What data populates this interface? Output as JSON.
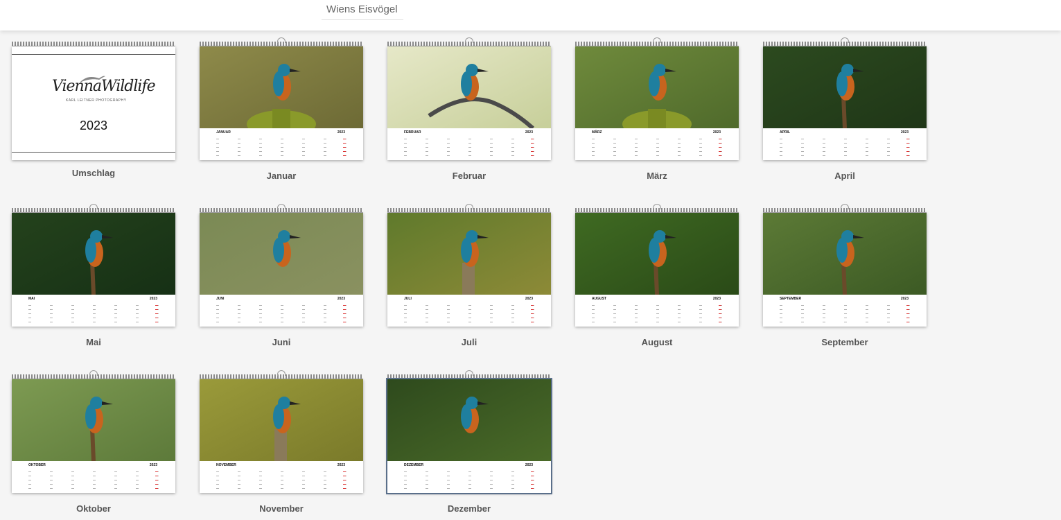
{
  "header": {
    "title": "Wiens Eisvögel"
  },
  "cover": {
    "label": "Umschlag",
    "logo": "ViennaWildlife",
    "logo_sub": "KARL LEITNER PHOTOGRAPHY",
    "year": "2023"
  },
  "months": [
    {
      "label": "Januar",
      "cal_name": "JANUAR",
      "year": "2023",
      "bg": [
        "#8e8a4a",
        "#6d6a35"
      ],
      "perch": "moss"
    },
    {
      "label": "Februar",
      "cal_name": "FEBRUAR",
      "year": "2023",
      "bg": [
        "#e6e8c8",
        "#c7cf9a"
      ],
      "perch": "branch"
    },
    {
      "label": "März",
      "cal_name": "MÄRZ",
      "year": "2023",
      "bg": [
        "#6f8a3c",
        "#4f6a2b"
      ],
      "perch": "moss"
    },
    {
      "label": "April",
      "cal_name": "APRIL",
      "year": "2023",
      "bg": [
        "#2c4a1f",
        "#1f3617"
      ],
      "perch": "stick"
    },
    {
      "label": "Mai",
      "cal_name": "MAI",
      "year": "2023",
      "bg": [
        "#24421c",
        "#163015"
      ],
      "perch": "stick"
    },
    {
      "label": "Juni",
      "cal_name": "JUNI",
      "year": "2023",
      "bg": [
        "#7b8a55",
        "#8a9160"
      ],
      "perch": "none"
    },
    {
      "label": "Juli",
      "cal_name": "JULI",
      "year": "2023",
      "bg": [
        "#5f7a2c",
        "#8d8a37"
      ],
      "perch": "stump"
    },
    {
      "label": "August",
      "cal_name": "AUGUST",
      "year": "2023",
      "bg": [
        "#3f6a22",
        "#2a4a17"
      ],
      "perch": "stick"
    },
    {
      "label": "September",
      "cal_name": "SEPTEMBER",
      "year": "2023",
      "bg": [
        "#5c7a36",
        "#3c5a24"
      ],
      "perch": "stick"
    },
    {
      "label": "Oktober",
      "cal_name": "OKTOBER",
      "year": "2023",
      "bg": [
        "#7d9a52",
        "#5d7a3a"
      ],
      "perch": "stick"
    },
    {
      "label": "November",
      "cal_name": "NOVEMBER",
      "year": "2023",
      "bg": [
        "#9a9a3a",
        "#7a7a2a"
      ],
      "perch": "stump"
    },
    {
      "label": "Dezember",
      "cal_name": "DEZEMBER",
      "year": "2023",
      "bg": [
        "#2e4a1d",
        "#4a6a28"
      ],
      "perch": "none"
    }
  ],
  "colors": {
    "bird_blue": "#1f7f9f",
    "bird_orange": "#c8641e",
    "selected_outline": "#5a6f8a"
  }
}
